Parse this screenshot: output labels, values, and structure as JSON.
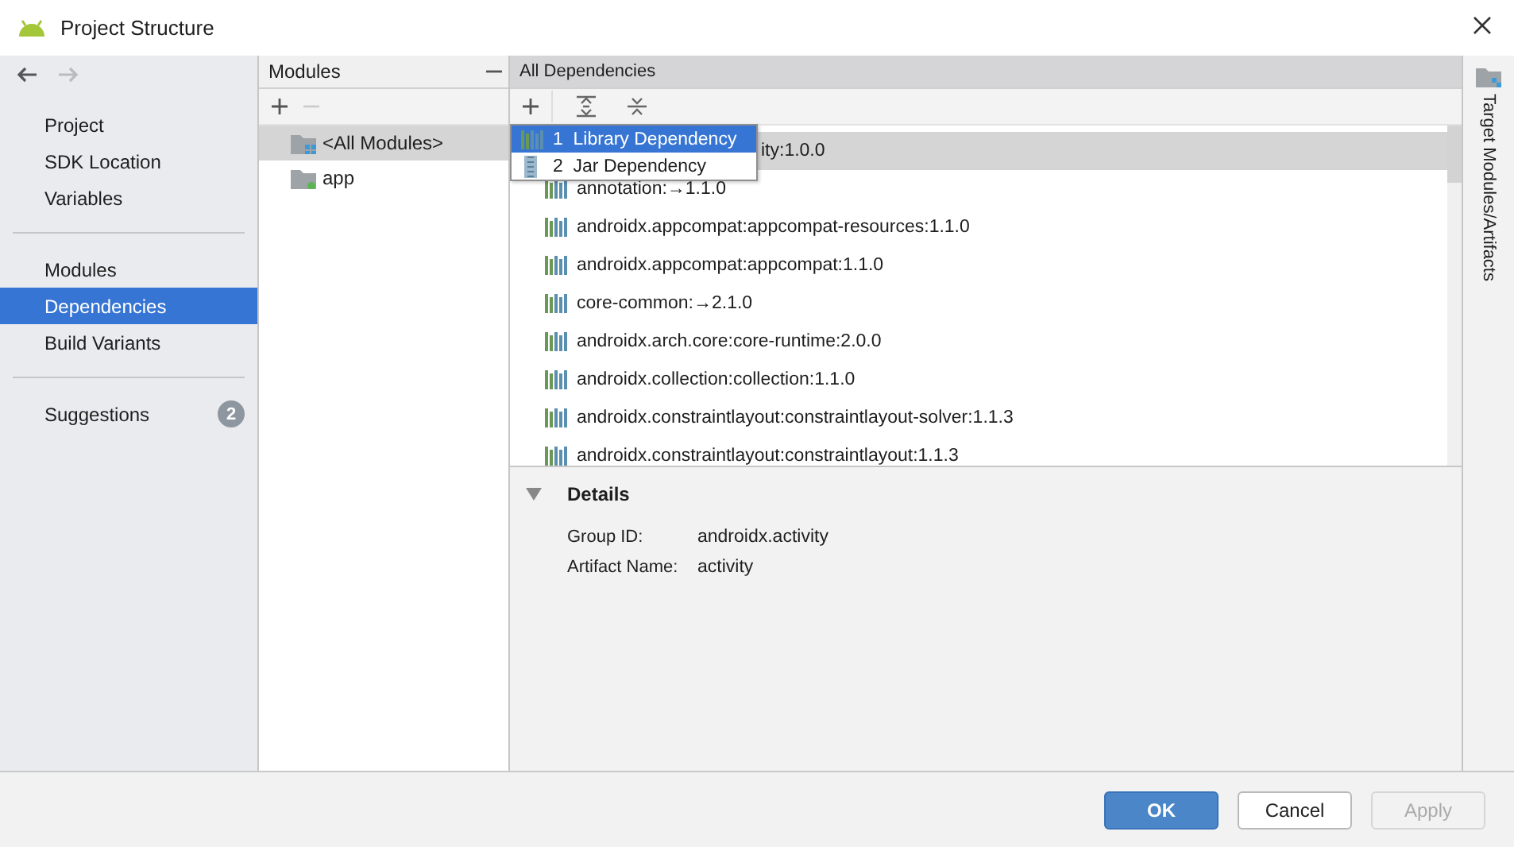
{
  "window": {
    "title": "Project Structure"
  },
  "nav": {
    "groups": [
      {
        "items": [
          {
            "label": "Project",
            "selected": false
          },
          {
            "label": "SDK Location",
            "selected": false
          },
          {
            "label": "Variables",
            "selected": false
          }
        ]
      },
      {
        "items": [
          {
            "label": "Modules",
            "selected": false
          },
          {
            "label": "Dependencies",
            "selected": true
          },
          {
            "label": "Build Variants",
            "selected": false
          }
        ]
      },
      {
        "items": [
          {
            "label": "Suggestions",
            "selected": false,
            "badge": "2"
          }
        ]
      }
    ]
  },
  "modules": {
    "title": "Modules",
    "items": [
      {
        "label": "<All Modules>",
        "selected": true,
        "kind": "all"
      },
      {
        "label": "app",
        "selected": false,
        "kind": "module"
      }
    ]
  },
  "dependencies": {
    "title": "All Dependencies",
    "rows": [
      {
        "text": "ity:1.0.0",
        "selected": true,
        "kind": "covered"
      },
      {
        "text": "annotation:→1.1.0",
        "selected": false,
        "kind": "library"
      },
      {
        "text": "androidx.appcompat:appcompat-resources:1.1.0",
        "selected": false,
        "kind": "library"
      },
      {
        "text": "androidx.appcompat:appcompat:1.1.0",
        "selected": false,
        "kind": "library"
      },
      {
        "text": "core-common:→2.1.0",
        "selected": false,
        "kind": "library"
      },
      {
        "text": "androidx.arch.core:core-runtime:2.0.0",
        "selected": false,
        "kind": "library"
      },
      {
        "text": "androidx.collection:collection:1.1.0",
        "selected": false,
        "kind": "library"
      },
      {
        "text": "androidx.constraintlayout:constraintlayout-solver:1.1.3",
        "selected": false,
        "kind": "library"
      },
      {
        "text": "androidx.constraintlayout:constraintlayout:1.1.3",
        "selected": false,
        "kind": "library"
      }
    ],
    "add_menu": [
      {
        "number": "1",
        "label": "Library Dependency",
        "selected": true,
        "kind": "library"
      },
      {
        "number": "2",
        "label": "Jar Dependency",
        "selected": false,
        "kind": "jar"
      }
    ],
    "details": {
      "title": "Details",
      "expanded": true,
      "fields": [
        {
          "label": "Group ID:",
          "value": "androidx.activity"
        },
        {
          "label": "Artifact Name:",
          "value": "activity"
        }
      ]
    }
  },
  "side_tab": {
    "label": "Target Modules/Artifacts"
  },
  "buttons": [
    {
      "label": "OK",
      "kind": "primary",
      "disabled": false
    },
    {
      "label": "Cancel",
      "kind": "normal",
      "disabled": false
    },
    {
      "label": "Apply",
      "kind": "normal",
      "disabled": true
    }
  ]
}
